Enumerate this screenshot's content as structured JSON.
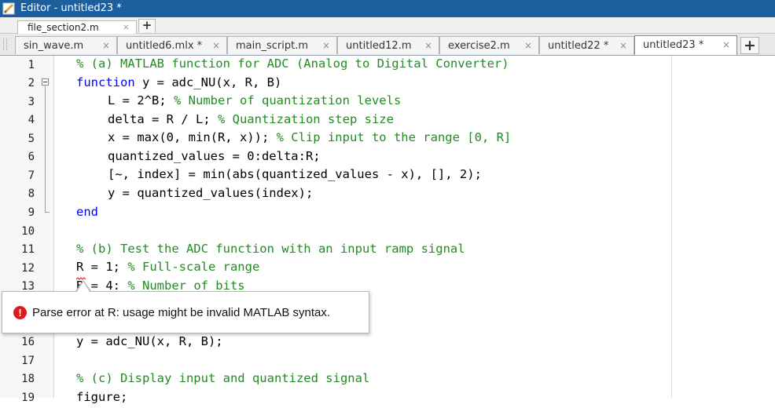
{
  "window": {
    "title": "Editor - untitled23 *"
  },
  "upper_tab": {
    "label": "file_section2.m",
    "close": "×",
    "add": "+"
  },
  "file_tabs": [
    {
      "label": "sin_wave.m",
      "close": "×"
    },
    {
      "label": "untitled6.mlx *",
      "close": "×"
    },
    {
      "label": "main_script.m",
      "close": "×"
    },
    {
      "label": "untitled12.m",
      "close": "×"
    },
    {
      "label": "exercise2.m",
      "close": "×"
    },
    {
      "label": "untitled22 *",
      "close": "×"
    },
    {
      "label": "untitled23 *",
      "close": "×",
      "active": true
    }
  ],
  "add_tab": "+",
  "line_numbers": [
    "1",
    "2",
    "3",
    "4",
    "5",
    "6",
    "7",
    "8",
    "9",
    "10",
    "11",
    "12",
    "13",
    "16",
    "17",
    "18",
    "19"
  ],
  "code": {
    "l1": "% (a) MATLAB function for ADC (Analog to Digital Converter)",
    "l2_kw": "function",
    "l2_rest": " y = adc_NU(x, R, B)",
    "l3_code": "L = 2^B; ",
    "l3_cm": "% Number of quantization levels",
    "l4_code": "delta = R / L; ",
    "l4_cm": "% Quantization step size",
    "l5_code": "x = max(0, min(R, x)); ",
    "l5_cm": "% Clip input to the range [0, R]",
    "l6": "quantized_values = 0:delta:R;",
    "l7": "[~, index] = min(abs(quantized_values - x), [], 2);",
    "l8": "y = quantized_values(index);",
    "l9": "end",
    "l11": "% (b) Test the ADC function with an input ramp signal",
    "l12_code": "R = 1; ",
    "l12_cm": "% Full-scale range",
    "l13_code": "B = 4; ",
    "l13_cm": "% Number of bits",
    "l16": "y = adc_NU(x, R, B);",
    "l18": "% (c) Display input and quantized signal",
    "l19": "figure;"
  },
  "tooltip": {
    "icon": "!",
    "message": "Parse error at R: usage might be invalid MATLAB syntax."
  },
  "colors": {
    "keyword": "#0000ff",
    "comment": "#228b22",
    "titlebar": "#1b5f9e",
    "error": "#e01b1b"
  }
}
